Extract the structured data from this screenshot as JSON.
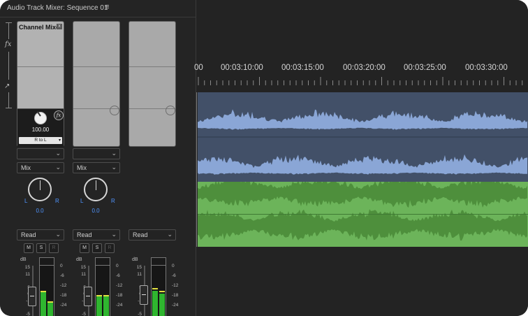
{
  "mixer": {
    "title": "Audio Track Mixer: Sequence 01",
    "menu_icon": "≡",
    "tools": {
      "fx": "fx",
      "keyframe_glyph": "↗"
    },
    "effect": {
      "name": "Channel Mixe",
      "close": "x",
      "fx_badge": "fx",
      "value": "100.00",
      "preset": "R to L",
      "preset_caret": "▾"
    },
    "tracks": [
      {
        "mix": "Mix",
        "pan_value": "0.0",
        "pan_left": "L",
        "pan_right": "R",
        "automation": "Read",
        "mute": "M",
        "solo": "S",
        "record": "R",
        "meter_levels": [
          0.48,
          0.28
        ],
        "peaks": [
          0.49,
          0.29
        ]
      },
      {
        "mix": "Mix",
        "pan_value": "0.0",
        "pan_left": "L",
        "pan_right": "R",
        "automation": "Read",
        "mute": "M",
        "solo": "S",
        "record": "R",
        "meter_levels": [
          0.4,
          0.4
        ],
        "peaks": [
          0.41,
          0.41
        ]
      },
      {
        "mix": "",
        "pan_value": "",
        "pan_left": "",
        "pan_right": "",
        "automation": "Read",
        "mute": "",
        "solo": "",
        "record": "",
        "meter_levels": [
          0.52,
          0.46
        ],
        "peaks": [
          0.54,
          0.48
        ]
      }
    ],
    "caret": "⌄",
    "db_label": "dB",
    "fader_scale": [
      "15",
      "11",
      "5",
      "0",
      "-1",
      "-5"
    ],
    "meter_scale": [
      "0",
      "-6",
      "-12",
      "-18",
      "-24"
    ]
  },
  "timeline": {
    "ruler_labels": [
      "00",
      "00:03:10:00",
      "00:03:15:00",
      "00:03:20:00",
      "00:03:25:00",
      "00:03:30:00"
    ],
    "tracks": [
      {
        "kind": "audio",
        "color": "#8aa6d6",
        "background": "#425068",
        "channels": 2,
        "seed": 7
      },
      {
        "kind": "audio",
        "color": "#4e8f3c",
        "background": "#6cb45a",
        "channels": 2,
        "seed": 13
      }
    ]
  },
  "colors": {
    "panel": "#242424",
    "accent_blue": "#4f95ff",
    "meter_green": "#2fb52f",
    "meter_peak": "#e1e141"
  }
}
